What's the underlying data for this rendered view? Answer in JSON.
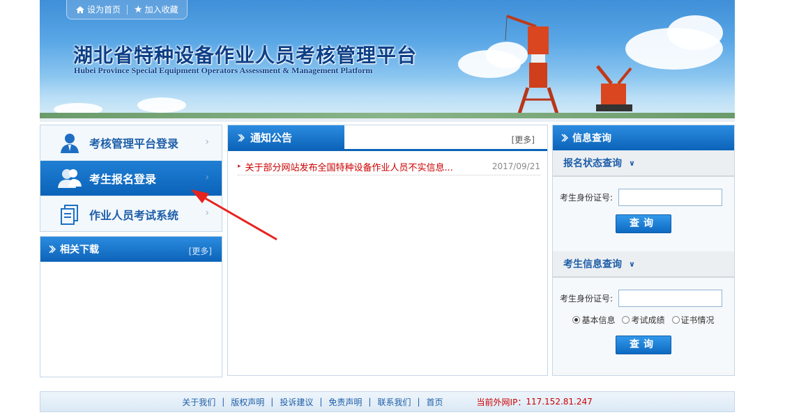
{
  "banner": {
    "quick_links": [
      {
        "label": "设为首页",
        "icon": "home-icon"
      },
      {
        "label": "加入收藏",
        "icon": "star-icon"
      }
    ],
    "title_cn": "湖北省特种设备作业人员考核管理平台",
    "title_en": "Hubei Province Special Equipment Operators Assessment & Management Platform"
  },
  "login_menu": {
    "items": [
      {
        "label": "考核管理平台登录",
        "icon": "user-suit-icon",
        "active": false
      },
      {
        "label": "考生报名登录",
        "icon": "users-icon",
        "active": true
      },
      {
        "label": "作业人员考试系统",
        "icon": "documents-icon",
        "active": false
      }
    ],
    "arrow_glyph": "›"
  },
  "downloads": {
    "title": "相关下载",
    "more": "[更多]"
  },
  "notice": {
    "title": "通知公告",
    "more": "[更多]",
    "items": [
      {
        "title": "关于部分网站发布全国特种设备作业人员不实信息...",
        "date": "2017/09/21"
      }
    ]
  },
  "query": {
    "title": "信息查询",
    "status_section": {
      "title": "报名状态查询",
      "id_label": "考生身份证号:",
      "id_value": "",
      "button": "查询"
    },
    "info_section": {
      "title": "考生信息查询",
      "id_label": "考生身份证号:",
      "id_value": "",
      "options": [
        "基本信息",
        "考试成绩",
        "证书情况"
      ],
      "selected": "基本信息",
      "button": "查询"
    }
  },
  "footer": {
    "links": [
      "关于我们",
      "版权声明",
      "投诉建议",
      "免责声明",
      "联系我们",
      "首页"
    ],
    "ip_label": "当前外网IP：",
    "ip_value": "117.152.81.247"
  },
  "colors": {
    "primary": "#0b63b8",
    "title_blue": "#1e5ea8",
    "notice_red": "#cc0000",
    "annotation_arrow": "#e8231f"
  }
}
